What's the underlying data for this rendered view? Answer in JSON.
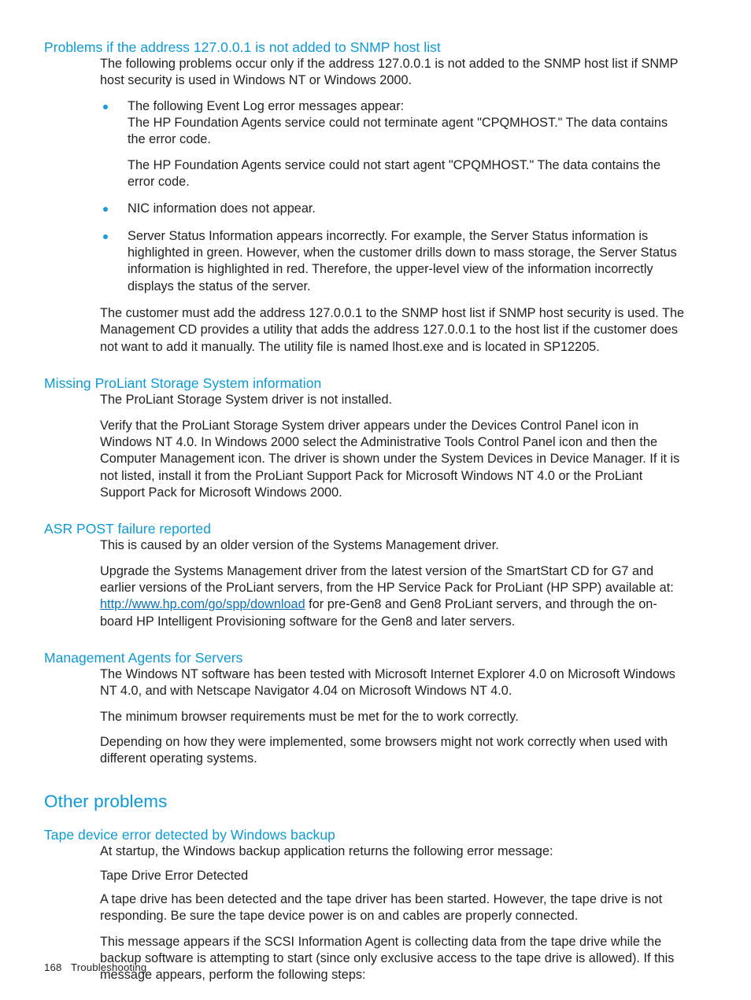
{
  "document": {
    "footer": {
      "page_number": "168",
      "section_title": "Troubleshooting"
    }
  },
  "sections": [
    {
      "id": "snmp-host-list",
      "level": "h2",
      "heading": "Problems if the address 127.0.0.1 is not added to SNMP host list",
      "intro": "The following problems occur only if the address 127.0.0.1 is not added to the SNMP host list if SNMP host security is used in Windows NT or Windows 2000.",
      "bullets": [
        {
          "text": "The following Event Log error messages appear:",
          "sub_paragraphs": [
            "The HP Foundation Agents  service could not terminate agent \"CPQMHOST.\" The data contains the error code.",
            "The HP Foundation Agents service could not start agent \"CPQMHOST.\" The data contains the error code."
          ]
        },
        {
          "text": "NIC information does not appear.",
          "sub_paragraphs": []
        },
        {
          "text": "Server Status Information appears incorrectly. For example, the Server Status information is highlighted in green. However, when the customer drills down to mass storage, the Server Status information is highlighted in red. Therefore, the upper-level view of the information incorrectly displays the status of the server.",
          "sub_paragraphs": []
        }
      ],
      "closing": "The customer must add the address 127.0.0.1 to the SNMP host list if SNMP host security is used. The Management CD provides a utility that adds the address 127.0.0.1 to the host list if the customer does not want to add it manually. The utility file is named lhost.exe and is located in SP12205."
    },
    {
      "id": "missing-proliant-storage",
      "level": "h2",
      "heading": "Missing ProLiant Storage System information",
      "paragraphs": [
        "The ProLiant Storage System driver is not installed.",
        "Verify that the ProLiant Storage System driver appears under the Devices Control Panel icon in Windows NT 4.0. In Windows 2000 select the Administrative Tools Control Panel icon and then the Computer Management icon. The driver is shown under the System Devices in Device Manager. If it is not listed, install it from the ProLiant Support Pack for Microsoft Windows NT 4.0 or the ProLiant Support Pack for Microsoft Windows 2000."
      ]
    },
    {
      "id": "asr-post-failure",
      "level": "h2",
      "heading": "ASR POST failure reported",
      "paragraphs": [
        "This is caused by an older version of the Systems Management driver."
      ],
      "link_paragraph": {
        "before": "Upgrade the Systems Management driver from the latest version of the SmartStart CD for G7 and earlier versions of the ProLiant servers, from the HP Service Pack for ProLiant (HP SPP) available at: ",
        "link_text": "http://www.hp.com/go/spp/download",
        "after": " for pre-Gen8 and Gen8 ProLiant servers, and through the on-board HP Intelligent Provisioning software for the Gen8 and later servers."
      }
    },
    {
      "id": "management-agents-servers",
      "level": "h2",
      "heading": "Management Agents for Servers",
      "paragraphs": [
        "The Windows NT software has been tested with Microsoft Internet Explorer 4.0 on Microsoft Windows NT 4.0, and with Netscape Navigator 4.04 on Microsoft Windows NT 4.0.",
        "The minimum browser requirements must be met for the to work correctly.",
        "Depending on how they were implemented, some browsers might not work correctly when used with different operating systems."
      ]
    },
    {
      "id": "other-problems",
      "level": "h1",
      "heading": "Other problems"
    },
    {
      "id": "tape-device-error",
      "level": "h2",
      "heading": "Tape device error detected by Windows backup",
      "paragraphs": [
        "At startup, the Windows backup application returns the following error message:",
        "Tape Drive Error Detected",
        "A tape drive has been detected and the tape driver has been started. However, the tape drive is not responding. Be sure the tape device power is on and cables are properly connected.",
        "This message appears if the SCSI Information Agent is collecting data from the tape drive while the backup software is attempting to start (since only exclusive access to the tape drive is allowed). If this message appears, perform the following steps:"
      ]
    }
  ],
  "colors": {
    "heading_blue": "#0c9ad7",
    "link_blue": "#0d72b9",
    "bullet_blue": "#1b9ad6",
    "body_text": "#231f20",
    "page_background": "#ffffff"
  }
}
